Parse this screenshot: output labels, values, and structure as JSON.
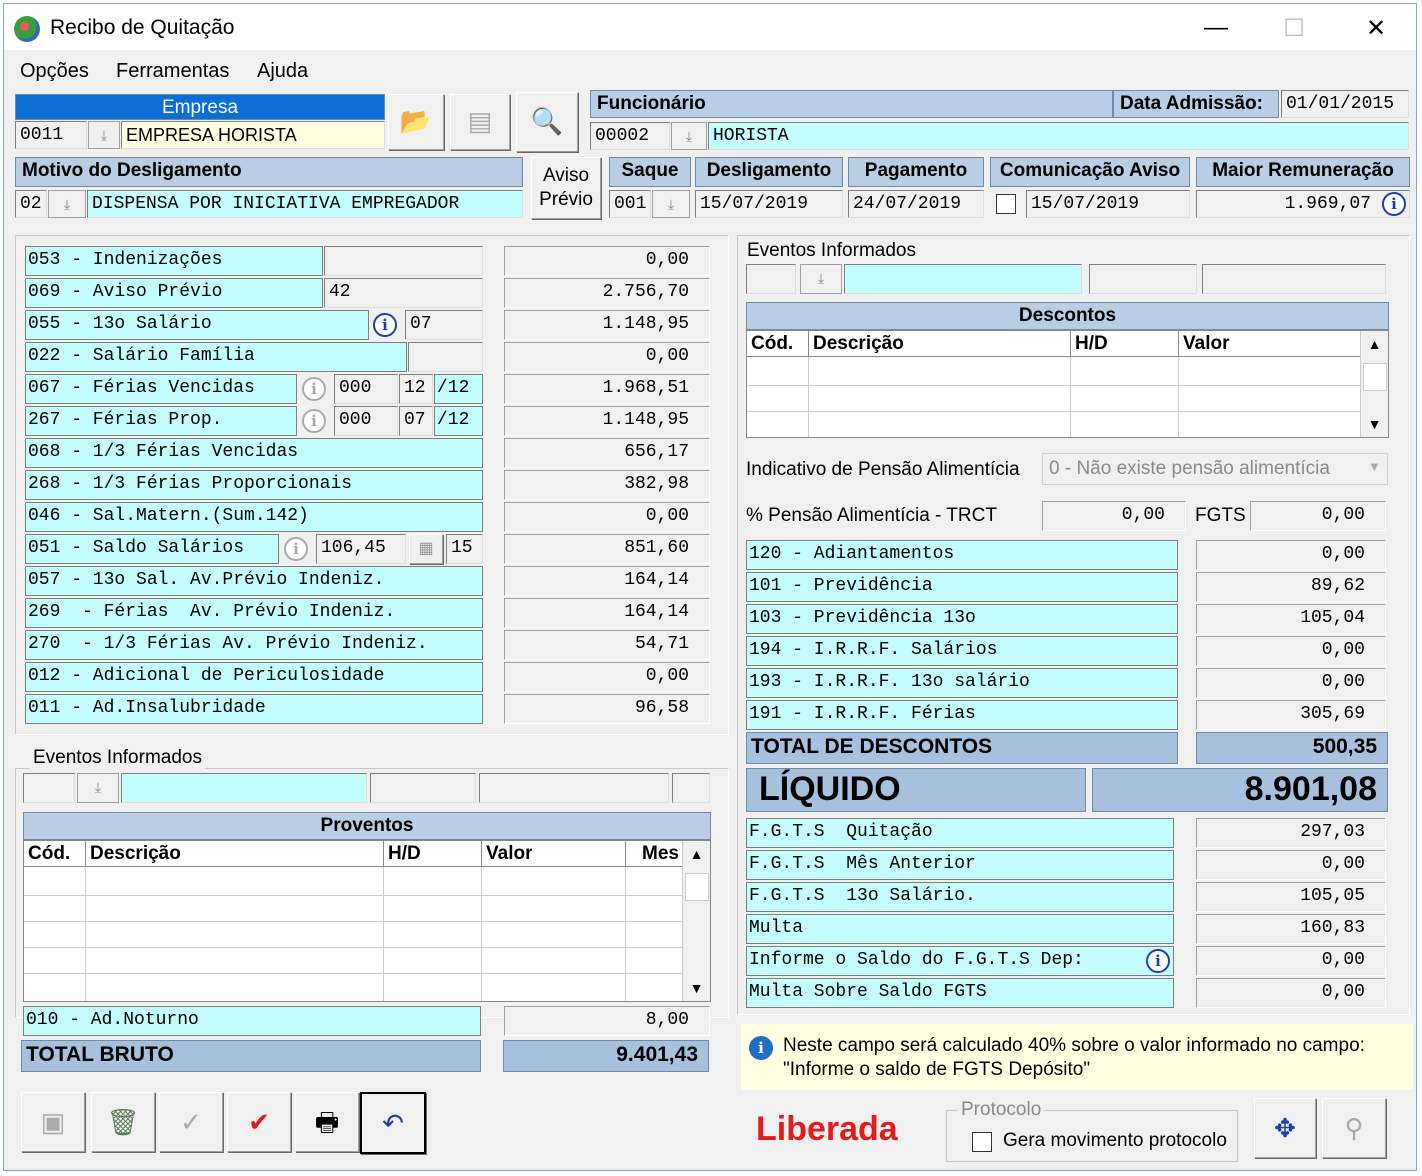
{
  "window": {
    "title": "Recibo de Quitação",
    "minimize": "—",
    "maximize": "☐",
    "close": "✕"
  },
  "menu": [
    "Opções",
    "Ferramentas",
    "Ajuda"
  ],
  "empresa": {
    "label": "Empresa",
    "code": "0011",
    "name": "EMPRESA HORISTA"
  },
  "funcionario": {
    "label": "Funcionário",
    "code": "00002",
    "name": "HORISTA",
    "admissao_label": "Data Admissão:",
    "admissao": "01/01/2015"
  },
  "motivo": {
    "label": "Motivo do Desligamento",
    "code": "02",
    "desc": "DISPENSA POR INICIATIVA EMPREGADOR"
  },
  "aviso_previo_btn": {
    "line1": "Aviso",
    "line2": "Prévio"
  },
  "saque": {
    "label": "Saque",
    "code": "001"
  },
  "desligamento": {
    "label": "Desligamento",
    "value": "15/07/2019"
  },
  "pagamento": {
    "label": "Pagamento",
    "value": "24/07/2019"
  },
  "comunicacao": {
    "label": "Comunicação Aviso",
    "value": "15/07/2019"
  },
  "maior_remuneracao": {
    "label": "Maior Remuneração",
    "value": "1.969,07"
  },
  "proventos_items": [
    {
      "label": "053 - Indenizações",
      "extra": "",
      "value": "0,00"
    },
    {
      "label": "069 - Aviso Prévio",
      "extra": "42",
      "value": "2.756,70"
    },
    {
      "label": "055 - 13o Salário",
      "extra": "07",
      "value": "1.148,95"
    },
    {
      "label": "022 - Salário Família",
      "extra": "",
      "value": "0,00"
    },
    {
      "label": "067 - Férias Vencidas",
      "extra": "000",
      "extra2": "12",
      "extra3": "/12",
      "value": "1.968,51"
    },
    {
      "label": "267 - Férias Prop.",
      "extra": "000",
      "extra2": "07",
      "extra3": "/12",
      "value": "1.148,95"
    },
    {
      "label": "068 - 1/3 Férias Vencidas",
      "value": "656,17"
    },
    {
      "label": "268 - 1/3 Férias Proporcionais",
      "value": "382,98"
    },
    {
      "label": "046 - Sal.Matern.(Sum.142)",
      "value": "0,00"
    },
    {
      "label": "051 - Saldo Salários",
      "extra": "106,45",
      "extra2": "15",
      "value": "851,60"
    },
    {
      "label": "057 - 13o Sal. Av.Prévio Indeniz.",
      "value": "164,14"
    },
    {
      "label": "269  - Férias  Av. Prévio Indeniz.",
      "value": "164,14"
    },
    {
      "label": "270  - 1/3 Férias Av. Prévio Indeniz.",
      "value": "54,71"
    },
    {
      "label": "012 - Adicional de Periculosidade",
      "value": "0,00"
    },
    {
      "label": "011 - Ad.Insalubridade",
      "value": "96,58"
    }
  ],
  "eventos_left": {
    "title": "Eventos Informados",
    "grid_title": "Proventos",
    "cols": [
      "Cód.",
      "Descrição",
      "H/D",
      "Valor",
      "Mes"
    ]
  },
  "ad_noturno": {
    "label": "010 - Ad.Noturno",
    "value": "8,00"
  },
  "total_bruto": {
    "label": "TOTAL BRUTO",
    "value": "9.401,43"
  },
  "eventos_right": {
    "title": "Eventos Informados",
    "grid_title": "Descontos",
    "cols": [
      "Cód.",
      "Descrição",
      "H/D",
      "Valor"
    ]
  },
  "pensao": {
    "label": "Indicativo de Pensão Alimentícia",
    "value": "0 - Não existe pensão alimentícia",
    "pct_label": "% Pensão Alimentícia - TRCT",
    "pct_value": "0,00",
    "fgts_label": "FGTS",
    "fgts_value": "0,00"
  },
  "descontos_items": [
    {
      "label": "120 - Adiantamentos",
      "value": "0,00"
    },
    {
      "label": "101 - Previdência",
      "value": "89,62"
    },
    {
      "label": "103 - Previdência 13o",
      "value": "105,04"
    },
    {
      "label": "194 - I.R.R.F. Salários",
      "value": "0,00"
    },
    {
      "label": "193 - I.R.R.F. 13o salário",
      "value": "0,00"
    },
    {
      "label": "191 - I.R.R.F. Férias",
      "value": "305,69"
    }
  ],
  "total_descontos": {
    "label": "TOTAL DE DESCONTOS",
    "value": "500,35"
  },
  "liquido": {
    "label": "LÍQUIDO",
    "value": "8.901,08"
  },
  "fgts_items": [
    {
      "label": "F.G.T.S  Quitação",
      "value": "297,03"
    },
    {
      "label": "F.G.T.S  Mês Anterior",
      "value": "0,00"
    },
    {
      "label": "F.G.T.S  13o Salário.",
      "value": "105,05"
    },
    {
      "label": "Multa",
      "value": "160,83"
    },
    {
      "label": "Informe o Saldo do F.G.T.S Dep:",
      "value": "0,00"
    },
    {
      "label": "Multa Sobre Saldo FGTS",
      "value": "0,00"
    }
  ],
  "info": {
    "line1": "Neste campo será calculado 40% sobre o valor informado no campo:",
    "line2": "\"Informe o saldo de FGTS Depósito\""
  },
  "status": "Liberada",
  "protocolo": {
    "title": "Protocolo",
    "checkbox_label": "Gera movimento protocolo"
  },
  "colors": {
    "header": "#b9cde5",
    "cyan": "#c4fdfd",
    "total": "#a6c0dd",
    "status": "#e21b1b",
    "empresa": "#0b6fd6"
  }
}
